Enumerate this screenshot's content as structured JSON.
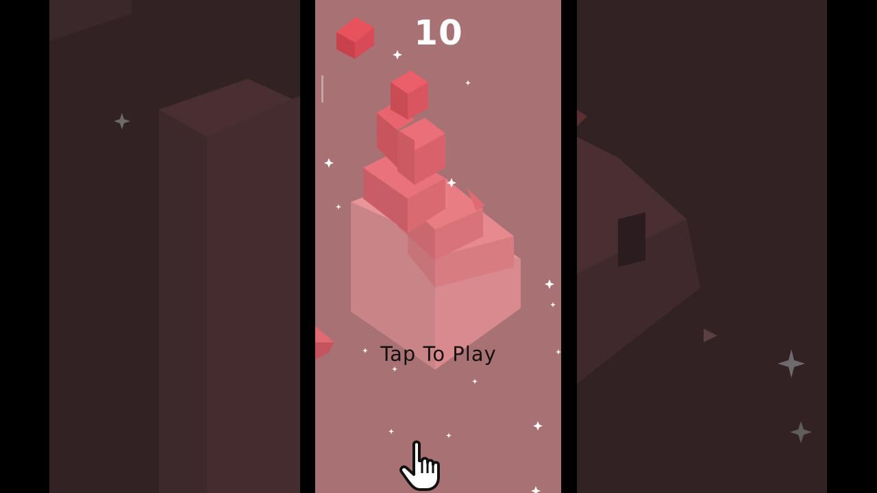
{
  "game": {
    "score": "10",
    "prompt": "Tap To Play"
  },
  "icons": {
    "block": "cube-icon",
    "pointer": "hand-pointer-icon",
    "sparkle": "sparkle-icon"
  },
  "colors": {
    "background": "#a87275",
    "block_top": "#e8707a",
    "block_left": "#c9565f",
    "block_right": "#dc6670",
    "side_panel": "#332224",
    "text_dark": "#141010",
    "score_text": "#ffffff"
  }
}
